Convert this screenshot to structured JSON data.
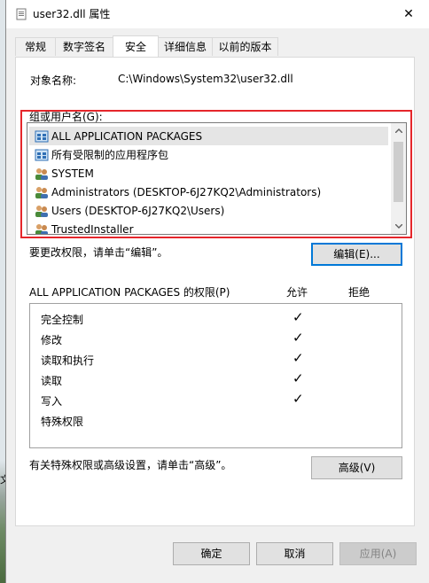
{
  "window": {
    "title": "user32.dll 属性",
    "close_glyph": "✕"
  },
  "tabs": [
    {
      "label": "常规"
    },
    {
      "label": "数字签名"
    },
    {
      "label": "安全"
    },
    {
      "label": "详细信息"
    },
    {
      "label": "以前的版本"
    }
  ],
  "active_tab": "安全",
  "object": {
    "label": "对象名称:",
    "value": "C:\\Windows\\System32\\user32.dll"
  },
  "groups": {
    "label": "组或用户名(G):",
    "items": [
      {
        "name": "ALL APPLICATION PACKAGES",
        "icon": "app-packages-icon",
        "selected": true
      },
      {
        "name": "所有受限制的应用程序包",
        "icon": "app-packages-icon",
        "selected": false
      },
      {
        "name": "SYSTEM",
        "icon": "users-icon",
        "selected": false
      },
      {
        "name": "Administrators (DESKTOP-6J27KQ2\\Administrators)",
        "icon": "users-icon",
        "selected": false
      },
      {
        "name": "Users (DESKTOP-6J27KQ2\\Users)",
        "icon": "users-icon",
        "selected": false
      },
      {
        "name": "TrustedInstaller",
        "icon": "users-icon",
        "selected": false
      }
    ]
  },
  "change_hint": "要更改权限，请单击“编辑”。",
  "edit_button": "编辑(E)...",
  "permissions": {
    "title": "ALL APPLICATION PACKAGES 的权限(P)",
    "allow_header": "允许",
    "deny_header": "拒绝",
    "rows": [
      {
        "name": "完全控制",
        "allow": true,
        "deny": false
      },
      {
        "name": "修改",
        "allow": true,
        "deny": false
      },
      {
        "name": "读取和执行",
        "allow": true,
        "deny": false
      },
      {
        "name": "读取",
        "allow": true,
        "deny": false
      },
      {
        "name": "写入",
        "allow": true,
        "deny": false
      },
      {
        "name": "特殊权限",
        "allow": false,
        "deny": false
      }
    ],
    "check_glyph": "✓"
  },
  "advanced_hint": "有关特殊权限或高级设置，请单击“高级”。",
  "advanced_button": "高级(V)",
  "buttons": {
    "ok": "确定",
    "cancel": "取消",
    "apply": "应用(A)"
  },
  "desktop_glyph": "文"
}
